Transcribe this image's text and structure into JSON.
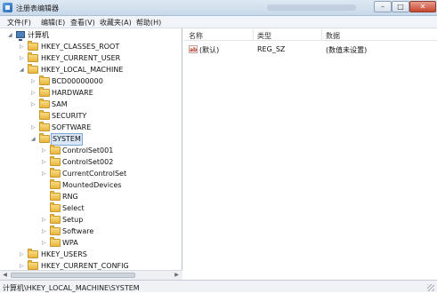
{
  "window": {
    "title": "注册表编辑器",
    "min_label": "–",
    "max_label": "□",
    "close_label": "✕"
  },
  "menu": {
    "items": [
      {
        "label": "文件(F)"
      },
      {
        "label": "编辑(E)"
      },
      {
        "label": "查看(V)"
      },
      {
        "label": "收藏夹(A)"
      },
      {
        "label": "帮助(H)"
      }
    ]
  },
  "tree": {
    "root": {
      "label": "计算机",
      "expanded": true
    },
    "hives": [
      {
        "label": "HKEY_CLASSES_ROOT"
      },
      {
        "label": "HKEY_CURRENT_USER"
      },
      {
        "label": "HKEY_LOCAL_MACHINE"
      }
    ],
    "hklm_children": [
      {
        "label": "BCD00000000"
      },
      {
        "label": "HARDWARE"
      },
      {
        "label": "SAM"
      },
      {
        "label": "SECURITY"
      },
      {
        "label": "SOFTWARE"
      },
      {
        "label": "SYSTEM",
        "selected": true
      }
    ],
    "system_children": [
      {
        "label": "ControlSet001"
      },
      {
        "label": "ControlSet002"
      },
      {
        "label": "CurrentControlSet"
      },
      {
        "label": "MountedDevices"
      },
      {
        "label": "RNG"
      },
      {
        "label": "Select"
      },
      {
        "label": "Setup"
      },
      {
        "label": "Software"
      },
      {
        "label": "WPA"
      }
    ],
    "tail_hives": [
      {
        "label": "HKEY_USERS"
      },
      {
        "label": "HKEY_CURRENT_CONFIG"
      }
    ]
  },
  "values": {
    "columns": [
      "名称",
      "类型",
      "数据"
    ],
    "rows": [
      {
        "name": "(默认)",
        "type": "REG_SZ",
        "data": "(数值未设置)",
        "icon": "ab-icon"
      }
    ]
  },
  "statusbar": {
    "path": "计算机\\HKEY_LOCAL_MACHINE\\SYSTEM"
  }
}
